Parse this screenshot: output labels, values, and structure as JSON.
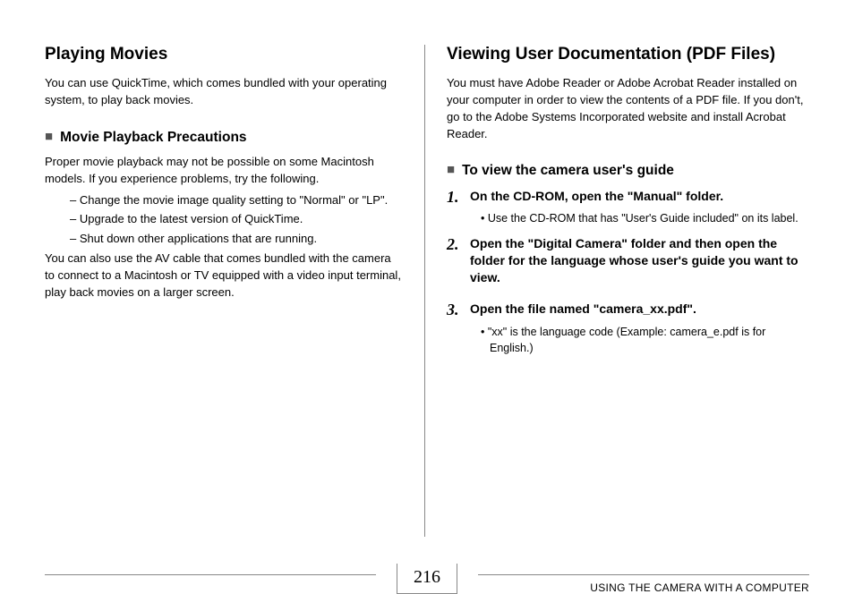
{
  "left": {
    "heading": "Playing Movies",
    "intro": "You can use QuickTime, which comes bundled with your operating system, to play back movies.",
    "sub_title": "Movie Playback Precautions",
    "body1": "Proper movie playback may not be possible on some Macintosh models. If you experience problems, try the following.",
    "dashes": [
      "Change the movie image quality setting to \"Normal\" or \"LP\".",
      "Upgrade to the latest version of QuickTime.",
      "Shut down other applications that are running."
    ],
    "body2": "You can also use the AV cable that comes bundled with the camera to connect to a Macintosh or TV equipped with a video input terminal, play back movies on a larger screen."
  },
  "right": {
    "heading": "Viewing User Documentation (PDF Files)",
    "intro": "You must have Adobe Reader or Adobe Acrobat Reader installed on your computer in order to view the contents of a PDF file. If you don't, go to the Adobe Systems Incorporated website and install Acrobat Reader.",
    "sub_title": "To view the camera user's guide",
    "steps": [
      {
        "num": "1.",
        "text": "On the CD-ROM, open the \"Manual\" folder.",
        "bullets": [
          "Use the CD-ROM that has \"User's Guide included\" on its label."
        ]
      },
      {
        "num": "2.",
        "text": "Open the \"Digital Camera\" folder and then open the folder for the language whose user's guide you want to view.",
        "bullets": []
      },
      {
        "num": "3.",
        "text": "Open the file named \"camera_xx.pdf\".",
        "bullets": [
          "\"xx\" is the language code (Example: camera_e.pdf is for English.)"
        ]
      }
    ]
  },
  "footer": {
    "page": "216",
    "section": "USING THE CAMERA WITH A COMPUTER"
  }
}
